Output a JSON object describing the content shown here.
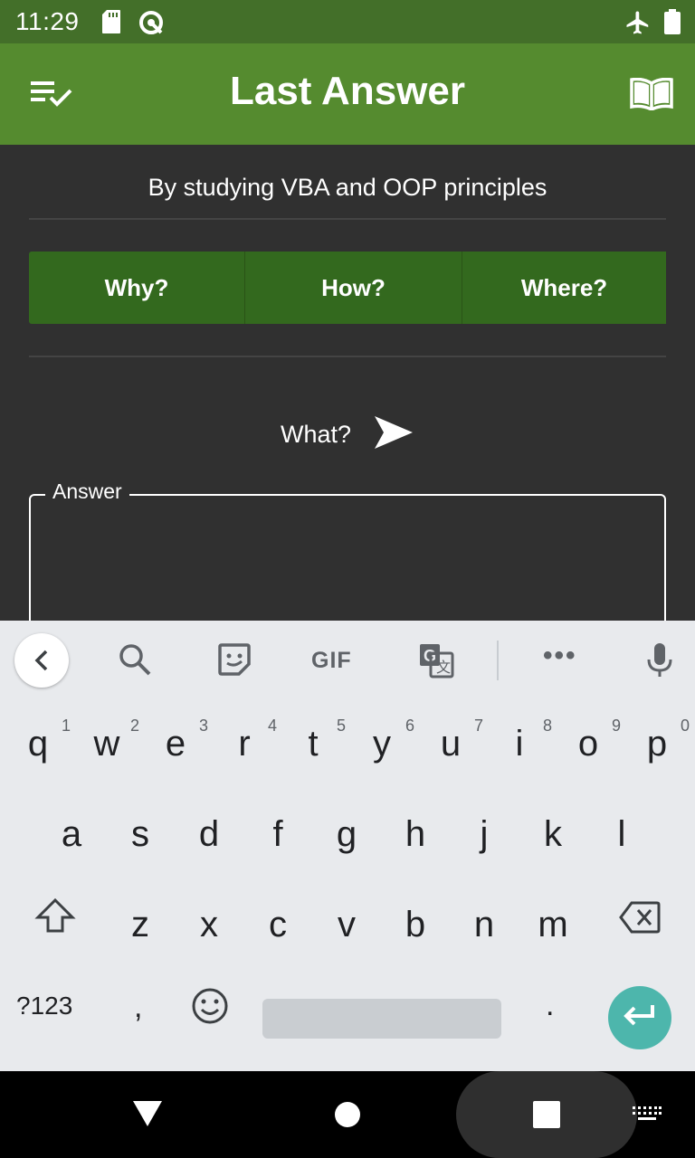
{
  "status_bar": {
    "time": "11:29",
    "icons": [
      "sd-card-icon",
      "sync-icon",
      "airplane-mode-icon",
      "battery-icon"
    ]
  },
  "app_bar": {
    "title": "Last Answer",
    "left_icon": "playlist-check-icon",
    "right_icon": "book-open-icon",
    "color": "#558b2f"
  },
  "main": {
    "question": "By studying VBA and OOP principles",
    "buttons": [
      "Why?",
      "How?",
      "Where?"
    ],
    "what_label": "What?",
    "answer_label": "Answer"
  },
  "keyboard": {
    "toolbar": [
      "back-icon",
      "search-icon",
      "sticker-icon",
      "gif",
      "translate-icon",
      "more-icon",
      "mic-icon"
    ],
    "gif_label": "GIF",
    "more_label": "•••",
    "row1": [
      "q",
      "w",
      "e",
      "r",
      "t",
      "y",
      "u",
      "i",
      "o",
      "p"
    ],
    "row1_hints": [
      "1",
      "2",
      "3",
      "4",
      "5",
      "6",
      "7",
      "8",
      "9",
      "0"
    ],
    "row2": [
      "a",
      "s",
      "d",
      "f",
      "g",
      "h",
      "j",
      "k",
      "l"
    ],
    "row3": [
      "z",
      "x",
      "c",
      "v",
      "b",
      "n",
      "m"
    ],
    "symbols_label": "?123",
    "comma": ",",
    "period": ".",
    "enter_color": "#4db6ac"
  },
  "nav_bar": {
    "icons": [
      "back-triangle-icon",
      "home-circle-icon",
      "recents-square-icon",
      "keyboard-switch-icon"
    ]
  }
}
